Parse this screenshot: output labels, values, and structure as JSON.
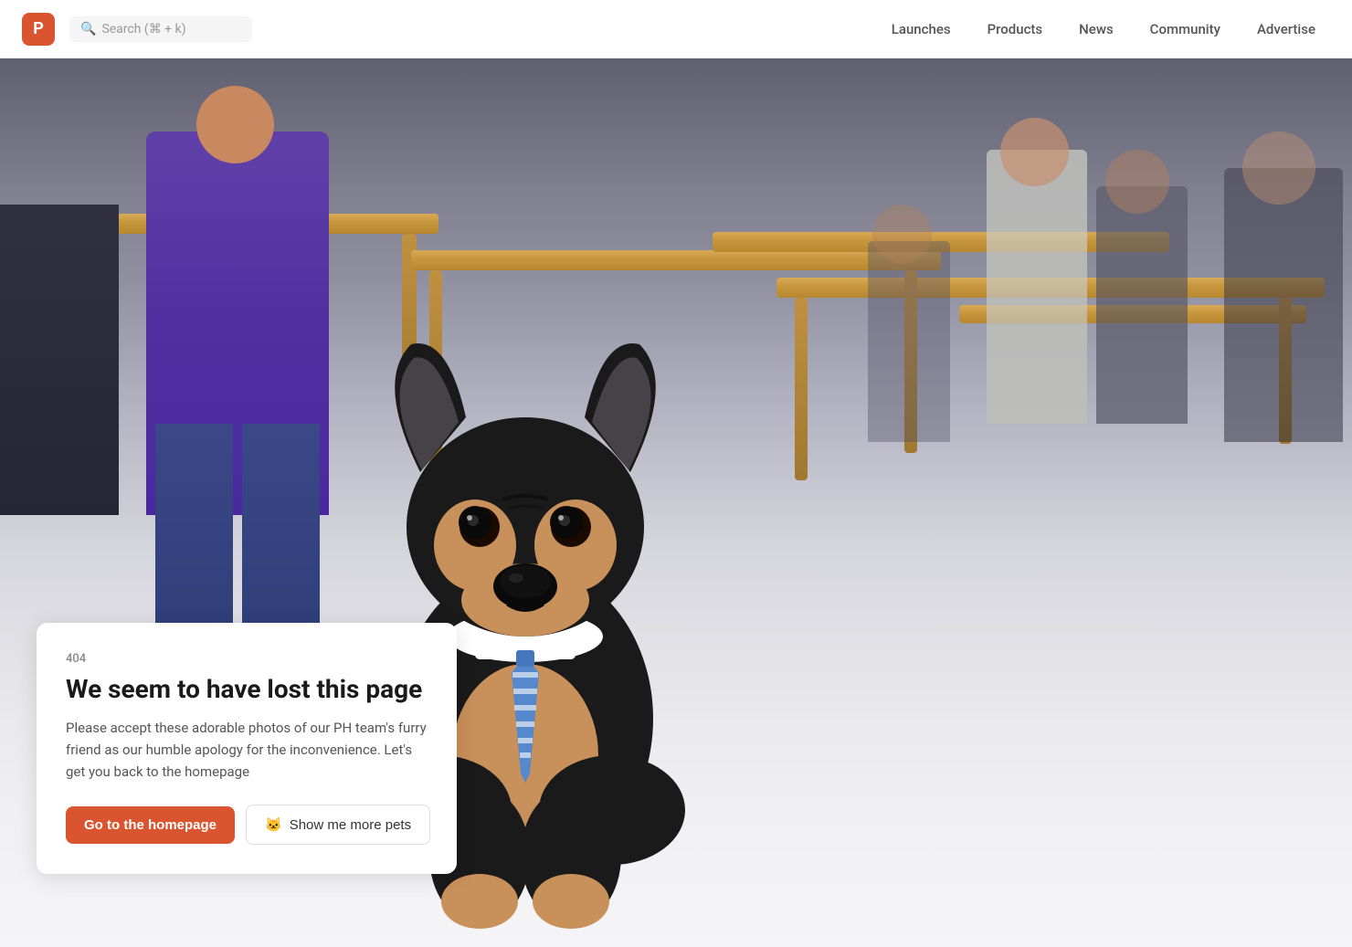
{
  "header": {
    "logo_letter": "P",
    "search_placeholder": "Search (⌘ + k)",
    "nav_items": [
      {
        "label": "Launches",
        "id": "launches"
      },
      {
        "label": "Products",
        "id": "products"
      },
      {
        "label": "News",
        "id": "news"
      },
      {
        "label": "Community",
        "id": "community"
      },
      {
        "label": "Advertise",
        "id": "advertise"
      }
    ]
  },
  "error_page": {
    "error_code": "404",
    "title": "We seem to have lost this page",
    "description": "Please accept these adorable photos of our PH team's furry friend as our humble apology for the inconvenience. Let's get you back to the homepage",
    "btn_homepage": "Go to the homepage",
    "btn_more_pets_emoji": "🐱",
    "btn_more_pets": "Show me more pets"
  },
  "colors": {
    "brand_red": "#da552f",
    "nav_text": "#555555",
    "header_bg": "#ffffff",
    "card_bg": "#ffffff",
    "error_code_color": "#888888",
    "title_color": "#1a1a1a",
    "description_color": "#555555"
  }
}
